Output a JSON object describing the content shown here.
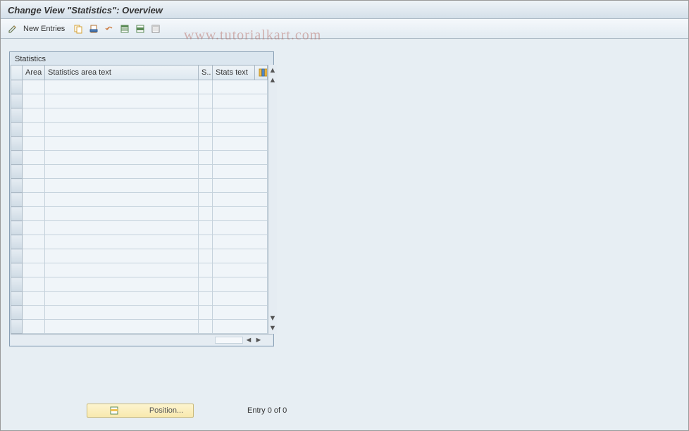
{
  "header": {
    "title": "Change View \"Statistics\": Overview"
  },
  "toolbar": {
    "new_entries_label": "New Entries"
  },
  "watermark": "www.tutorialkart.com",
  "grid": {
    "title": "Statistics",
    "columns": {
      "area": "Area",
      "area_text": "Statistics area text",
      "s": "S..",
      "stats_text": "Stats text"
    }
  },
  "footer": {
    "position_label": "Position...",
    "entry_text": "Entry 0 of 0"
  }
}
